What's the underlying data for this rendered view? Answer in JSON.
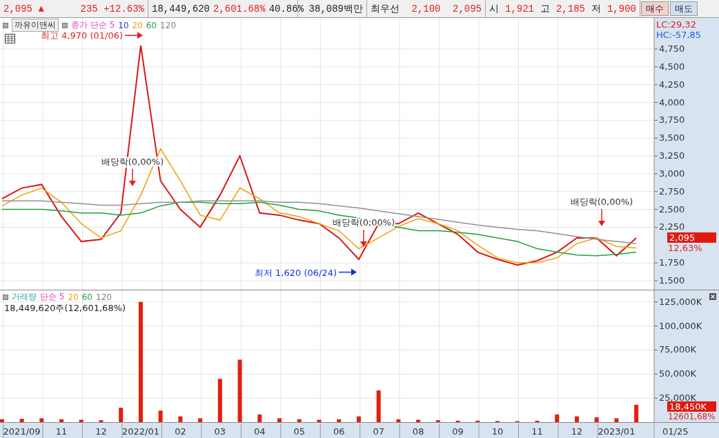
{
  "top_bar": {
    "price": "2,095",
    "arrow": "▲",
    "change": "235",
    "change_rate": "+12.63%",
    "volume": "18,449,620",
    "volume_rate": "2,601.68%",
    "ratio": "40.86%",
    "amount": "38,089백만",
    "best_label": "최우선",
    "best_ask": "2,100",
    "best_bid": "2,095",
    "quotes": [
      {
        "label": "시",
        "value": "1,921"
      },
      {
        "label": "고",
        "value": "2,185"
      },
      {
        "label": "저",
        "value": "1,900"
      }
    ],
    "buttons": [
      {
        "label": "매수",
        "kind": "buy"
      },
      {
        "label": "매도",
        "kind": "sell"
      }
    ]
  },
  "price_pane": {
    "stock_name": "까유이앤씨",
    "legend": [
      {
        "label": "종가 단순 5",
        "color": "#e040c0"
      },
      {
        "label": "10",
        "color": "#2040c0"
      },
      {
        "label": "20",
        "color": "#f0a000"
      },
      {
        "label": "60",
        "color": "#20a040"
      },
      {
        "label": "120",
        "color": "#808080"
      }
    ],
    "lc": "LC:29,32",
    "hc": "HC:-57,85",
    "current_tag": "2,095",
    "current_rate": "12,63%",
    "markers": [
      {
        "kind": "high",
        "text": "최고 4,970 (01/06)",
        "color": "#e02020"
      },
      {
        "kind": "dividend",
        "text": "배당락(0,00%)",
        "color": "#e02020"
      },
      {
        "kind": "dividend",
        "text": "배당락(0,00%)",
        "color": "#e02020"
      },
      {
        "kind": "low",
        "text": "최저 1,620 (06/24)",
        "color": "#1030e0"
      },
      {
        "kind": "dividend",
        "text": "배당락(0,00%)",
        "color": "#e02020"
      }
    ],
    "chart_data": {
      "type": "line",
      "grid": true,
      "ylim": [
        1374,
        5185
      ],
      "yticks": [
        {
          "value": 1500,
          "label": "1,500"
        },
        {
          "value": 1750,
          "label": "1,750"
        },
        {
          "value": 2250,
          "label": "2,250"
        },
        {
          "value": 2500,
          "label": "2,500"
        },
        {
          "value": 2750,
          "label": "2,750"
        },
        {
          "value": 3000,
          "label": "3,000"
        },
        {
          "value": 3250,
          "label": "3,250"
        },
        {
          "value": 3500,
          "label": "3,500"
        },
        {
          "value": 3750,
          "label": "3,750"
        },
        {
          "value": 4000,
          "label": "4,000"
        },
        {
          "value": 4250,
          "label": "4,250"
        },
        {
          "value": 4500,
          "label": "4,500"
        },
        {
          "value": 4750,
          "label": "4,750"
        }
      ],
      "series": [
        {
          "color": "#d81818",
          "values": [
            2650,
            2800,
            2850,
            2400,
            2050,
            2080,
            2450,
            4800,
            2900,
            2500,
            2250,
            2700,
            3250,
            2450,
            2420,
            2350,
            2300,
            2100,
            1800,
            2300,
            2300,
            2450,
            2300,
            2150,
            1900,
            1800,
            1720,
            1780,
            1900,
            2100,
            2100,
            1850,
            2100
          ]
        },
        {
          "color": "#f0a000",
          "values": [
            2550,
            2700,
            2800,
            2600,
            2300,
            2100,
            2200,
            2700,
            3350,
            2900,
            2420,
            2350,
            2800,
            2650,
            2450,
            2400,
            2300,
            2200,
            1950,
            2100,
            2260,
            2370,
            2300,
            2200,
            2000,
            1820,
            1750,
            1750,
            1820,
            2020,
            2100,
            1980,
            1960
          ]
        },
        {
          "color": "#20a040",
          "values": [
            2500,
            2500,
            2500,
            2480,
            2450,
            2450,
            2420,
            2450,
            2550,
            2600,
            2600,
            2580,
            2580,
            2600,
            2560,
            2500,
            2480,
            2420,
            2380,
            2300,
            2250,
            2200,
            2200,
            2180,
            2150,
            2100,
            2050,
            1950,
            1900,
            1860,
            1850,
            1870,
            1900
          ]
        },
        {
          "color": "#909090",
          "values": [
            2620,
            2620,
            2620,
            2600,
            2580,
            2560,
            2560,
            2580,
            2600,
            2600,
            2620,
            2620,
            2620,
            2620,
            2600,
            2600,
            2580,
            2550,
            2520,
            2480,
            2440,
            2400,
            2360,
            2320,
            2280,
            2250,
            2220,
            2200,
            2160,
            2120,
            2080,
            2050,
            2020
          ]
        }
      ]
    }
  },
  "volume_pane": {
    "legend": [
      {
        "label": "거래량",
        "color": "#30a0a8"
      },
      {
        "label": "단순 5",
        "color": "#e040c0"
      },
      {
        "label": "20",
        "color": "#f0a000"
      },
      {
        "label": "60",
        "color": "#20a040"
      },
      {
        "label": "120",
        "color": "#808080"
      }
    ],
    "summary": "18,449,620주(12,601,68%)",
    "current_tag": "18,450K",
    "current_rate": "12601,68%",
    "chart_data": {
      "type": "bar",
      "grid": true,
      "ylim": [
        0,
        137000
      ],
      "categories": [
        null,
        "2021/09",
        null,
        "11",
        null,
        "12",
        null,
        "2022/01",
        null,
        "02",
        null,
        "03",
        null,
        "04",
        null,
        "05",
        null,
        "06",
        null,
        "07",
        null,
        "08",
        null,
        "09",
        null,
        "10",
        null,
        "11",
        null,
        "12",
        null,
        "2023/01",
        null
      ],
      "yticks": [
        {
          "value": 25000,
          "label": "25,000K"
        },
        {
          "value": 50000,
          "label": "50,000K"
        },
        {
          "value": 75000,
          "label": "75,000K"
        },
        {
          "value": 100000,
          "label": "100,000K"
        },
        {
          "value": 125000,
          "label": "125,000K"
        }
      ],
      "series": [
        {
          "color": "#e02010",
          "values": [
            3000,
            3500,
            4000,
            3000,
            2500,
            2000,
            15000,
            125000,
            12000,
            6000,
            4000,
            45000,
            65000,
            8000,
            4000,
            3000,
            2500,
            3000,
            6000,
            33000,
            3000,
            2500,
            2000,
            1500,
            1500,
            1200,
            1000,
            1500,
            8000,
            6000,
            5000,
            4000,
            18000
          ]
        }
      ]
    }
  },
  "date_axis": {
    "current": "01/25"
  }
}
